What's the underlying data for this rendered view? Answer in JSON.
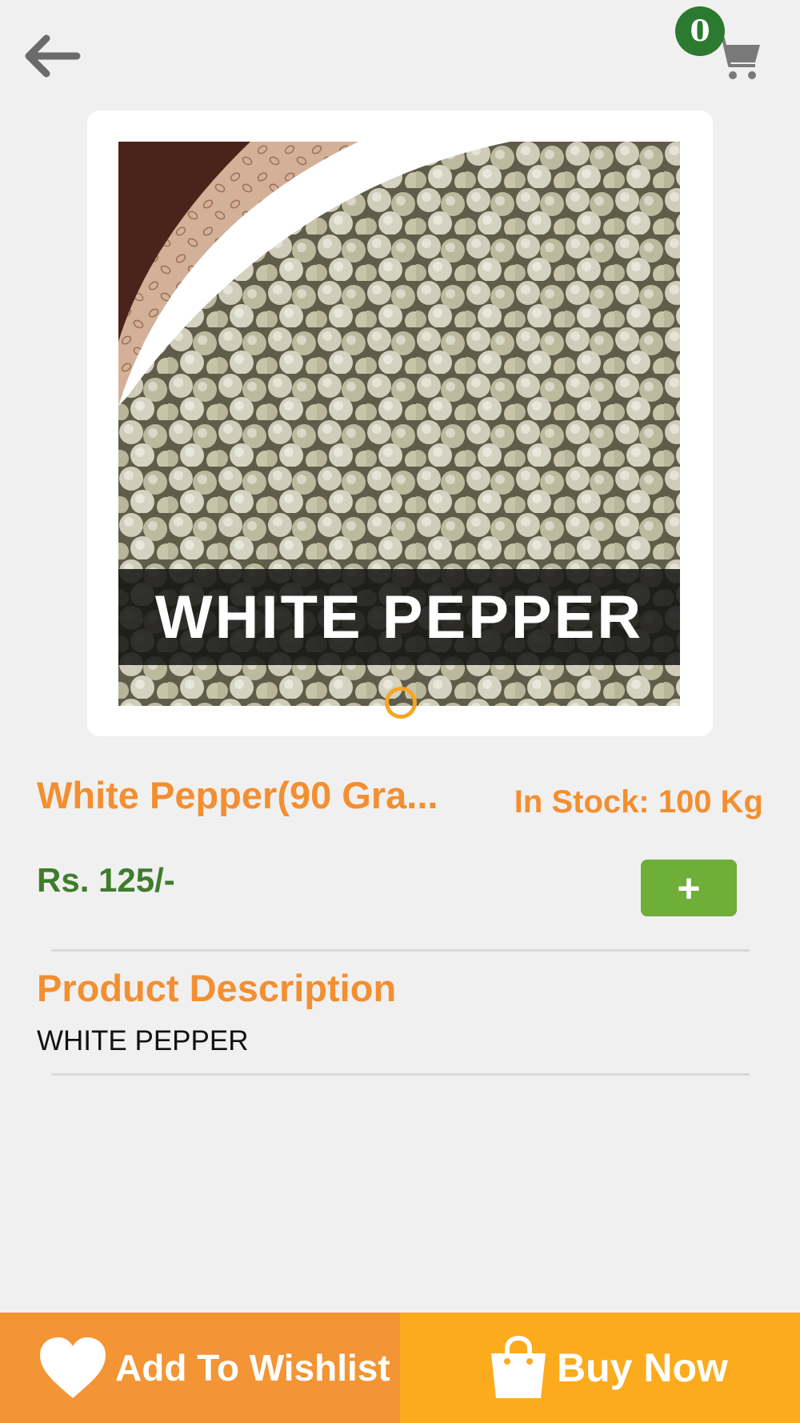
{
  "header": {
    "cart_count": "0"
  },
  "product": {
    "image_banner_text": "WHITE PEPPER",
    "title": "White Pepper(90 Gra...",
    "stock": "In Stock: 100 Kg",
    "price": "Rs. 125/-",
    "add_label": "+"
  },
  "description": {
    "heading": "Product Description",
    "text": "WHITE PEPPER"
  },
  "actions": {
    "wishlist_label": "Add To Wishlist",
    "buy_label": "Buy Now"
  },
  "icons": {
    "back": "back-arrow-icon",
    "cart": "cart-icon",
    "wishlist": "heart-icon",
    "buy": "shopping-bag-icon"
  },
  "colors": {
    "accent_orange": "#f38f31",
    "price_green": "#3f7d2c",
    "add_button_green": "#6fae38",
    "cart_badge_green": "#2b7a2f",
    "wishlist_bar": "#f39435",
    "buy_now_bar": "#fbab1c"
  }
}
